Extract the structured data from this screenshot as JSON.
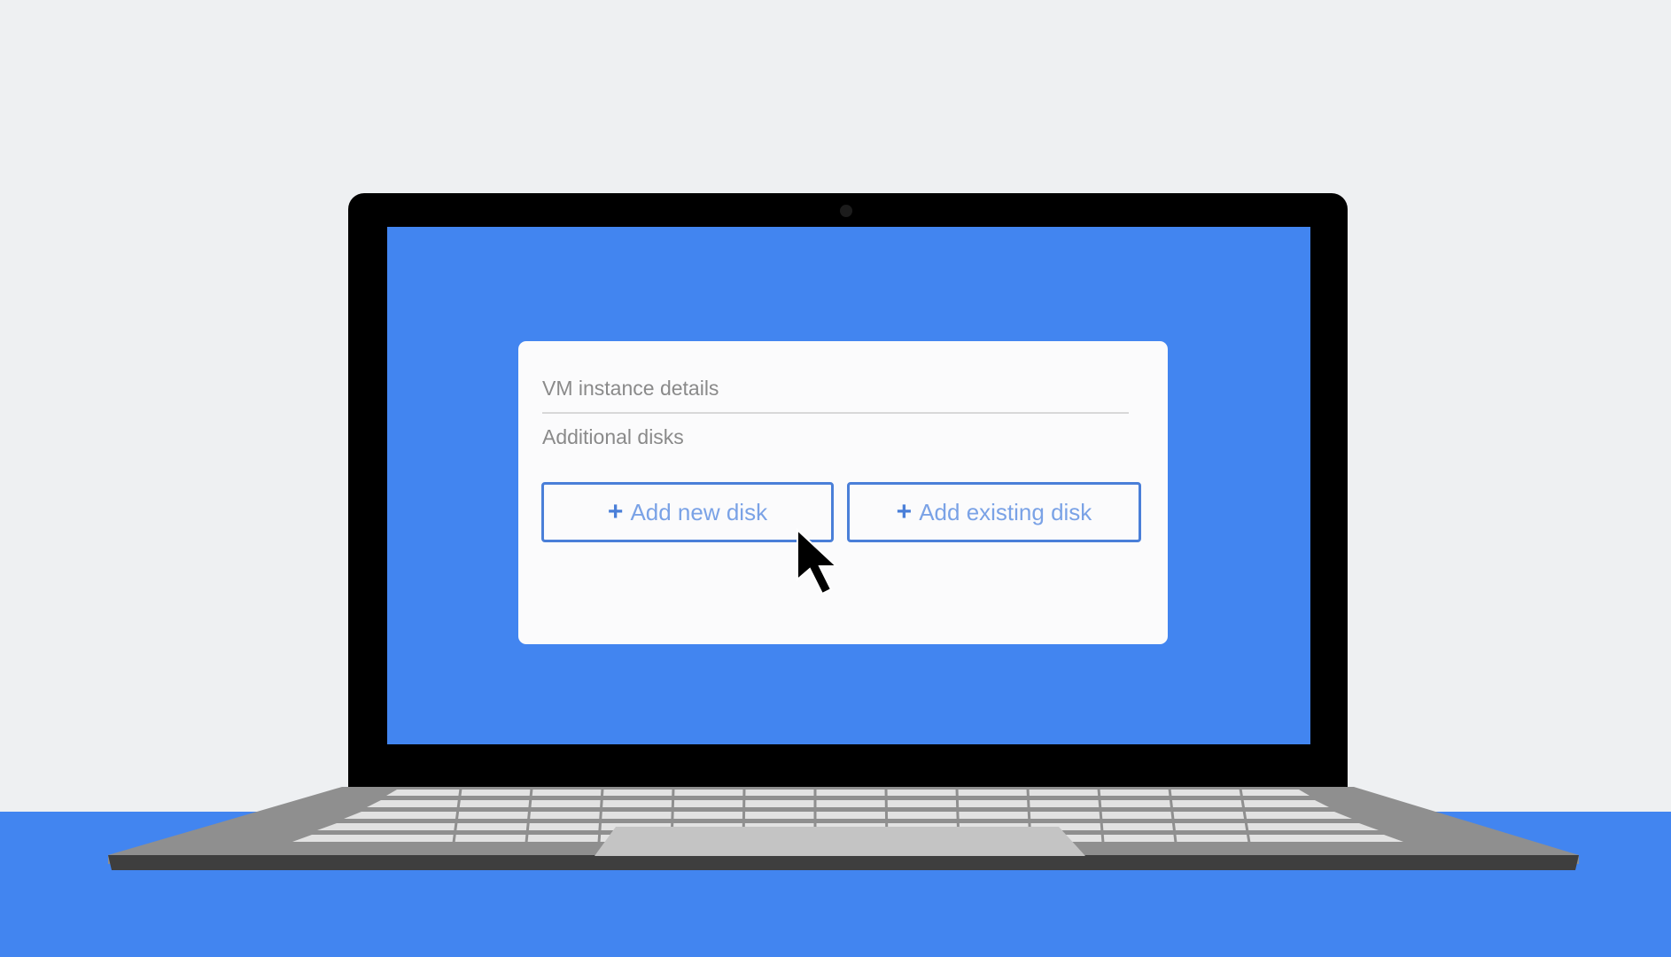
{
  "dialog": {
    "title": "VM instance details",
    "section_label": "Additional disks",
    "buttons": [
      {
        "label": "Add new disk",
        "icon": "plus-icon"
      },
      {
        "label": "Add existing disk",
        "icon": "plus-icon"
      }
    ]
  },
  "icons": {
    "plus": "+",
    "cursor": "mouse-pointer-icon"
  },
  "colors": {
    "background": "#eef0f2",
    "accent_blue": "#4285f0",
    "button_border": "#4a7fd8",
    "button_text": "#7aa2e6",
    "laptop_bezel": "#000000",
    "laptop_base": "#8f8f8f"
  }
}
